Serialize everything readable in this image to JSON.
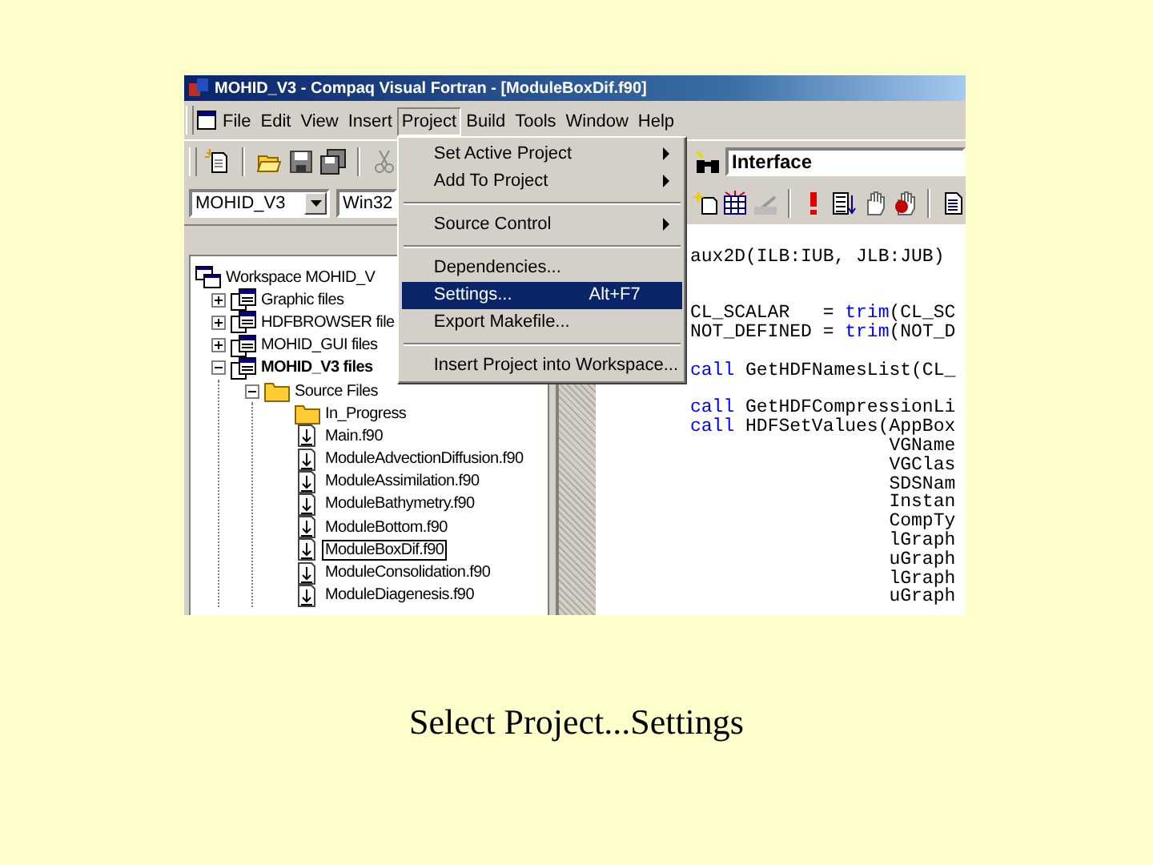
{
  "window": {
    "title": "MOHID_V3 - Compaq Visual Fortran - [ModuleBoxDif.f90]"
  },
  "menu_bar": [
    {
      "label": "File",
      "selected": false
    },
    {
      "label": "Edit",
      "selected": false
    },
    {
      "label": "View",
      "selected": false
    },
    {
      "label": "Insert",
      "selected": false
    },
    {
      "label": "Project",
      "selected": true
    },
    {
      "label": "Build",
      "selected": false
    },
    {
      "label": "Tools",
      "selected": false
    },
    {
      "label": "Window",
      "selected": false
    },
    {
      "label": "Help",
      "selected": false
    }
  ],
  "project_menu": {
    "items": [
      {
        "kind": "item",
        "label": "Set Active Project",
        "submenu": true,
        "selected": false
      },
      {
        "kind": "item",
        "label": "Add To Project",
        "submenu": true,
        "selected": false
      },
      {
        "kind": "separator"
      },
      {
        "kind": "item",
        "label": "Source Control",
        "submenu": true,
        "selected": false
      },
      {
        "kind": "separator"
      },
      {
        "kind": "item",
        "label": "Dependencies...",
        "submenu": false,
        "selected": false
      },
      {
        "kind": "item",
        "label": "Settings...",
        "shortcut": "Alt+F7",
        "submenu": false,
        "selected": true
      },
      {
        "kind": "item",
        "label": "Export Makefile...",
        "submenu": false,
        "selected": false
      },
      {
        "kind": "separator"
      },
      {
        "kind": "item",
        "label": "Insert Project into Workspace...",
        "submenu": false,
        "selected": false
      }
    ]
  },
  "toolbar": {
    "find_combo": "Interface",
    "project_combo": "MOHID_V3",
    "config_combo": "Win32"
  },
  "workspace": {
    "tree": [
      {
        "label": "Workspace MOHID_V",
        "kind": "workspace",
        "bold": false,
        "selected": false,
        "children": [
          {
            "label": "Graphic files",
            "kind": "project",
            "expanded": false,
            "bold": false,
            "selected": false
          },
          {
            "label": "HDFBROWSER file",
            "kind": "project",
            "expanded": false,
            "bold": false,
            "selected": false
          },
          {
            "label": "MOHID_GUI files",
            "kind": "project",
            "expanded": false,
            "bold": false,
            "selected": false
          },
          {
            "label": "MOHID_V3 files",
            "kind": "project",
            "expanded": true,
            "bold": true,
            "selected": false,
            "children": [
              {
                "label": "Source Files",
                "kind": "folder",
                "expanded": true,
                "bold": false,
                "selected": false,
                "children": [
                  {
                    "label": "In_Progress",
                    "kind": "folder",
                    "bold": false,
                    "selected": false
                  },
                  {
                    "label": "Main.f90",
                    "kind": "file",
                    "bold": false,
                    "selected": false
                  },
                  {
                    "label": "ModuleAdvectionDiffusion.f90",
                    "kind": "file",
                    "bold": false,
                    "selected": false
                  },
                  {
                    "label": "ModuleAssimilation.f90",
                    "kind": "file",
                    "bold": false,
                    "selected": false
                  },
                  {
                    "label": "ModuleBathymetry.f90",
                    "kind": "file",
                    "bold": false,
                    "selected": false
                  },
                  {
                    "label": "ModuleBottom.f90",
                    "kind": "file",
                    "bold": false,
                    "selected": false
                  },
                  {
                    "label": "ModuleBoxDif.f90",
                    "kind": "file",
                    "bold": false,
                    "selected": true
                  },
                  {
                    "label": "ModuleConsolidation.f90",
                    "kind": "file",
                    "bold": false,
                    "selected": false
                  },
                  {
                    "label": "ModuleDiagenesis.f90",
                    "kind": "file",
                    "bold": false,
                    "selected": false
                  }
                ]
              }
            ]
          }
        ]
      }
    ]
  },
  "editor": {
    "lines": [
      {
        "kind": "code",
        "segments": [
          {
            "kind": "plain",
            "text": "aux2D(ILB:IUB, JLB:JUB)"
          }
        ]
      },
      {
        "kind": "blank"
      },
      {
        "kind": "blank"
      },
      {
        "kind": "code",
        "segments": [
          {
            "kind": "plain",
            "text": "CL_SCALAR   = "
          },
          {
            "kind": "keyword",
            "text": "trim"
          },
          {
            "kind": "plain",
            "text": "(CL_SC"
          }
        ]
      },
      {
        "kind": "code",
        "segments": [
          {
            "kind": "plain",
            "text": "NOT_DEFINED = "
          },
          {
            "kind": "keyword",
            "text": "trim"
          },
          {
            "kind": "plain",
            "text": "(NOT_D"
          }
        ]
      },
      {
        "kind": "blank"
      },
      {
        "kind": "code",
        "segments": [
          {
            "kind": "keyword",
            "text": "call"
          },
          {
            "kind": "plain",
            "text": " GetHDFNamesList(CL_"
          }
        ]
      },
      {
        "kind": "blank"
      },
      {
        "kind": "code",
        "segments": [
          {
            "kind": "keyword",
            "text": "call"
          },
          {
            "kind": "plain",
            "text": " GetHDFCompressionLi"
          }
        ]
      },
      {
        "kind": "code",
        "segments": [
          {
            "kind": "keyword",
            "text": "call"
          },
          {
            "kind": "plain",
            "text": " HDFSetValues(AppBox"
          }
        ]
      },
      {
        "kind": "continued",
        "segments": [
          {
            "kind": "plain",
            "text": "VGName"
          }
        ]
      },
      {
        "kind": "continued",
        "segments": [
          {
            "kind": "plain",
            "text": "VGClas"
          }
        ]
      },
      {
        "kind": "continued",
        "segments": [
          {
            "kind": "plain",
            "text": "SDSNam"
          }
        ]
      },
      {
        "kind": "continued",
        "segments": [
          {
            "kind": "plain",
            "text": "Instan"
          }
        ]
      },
      {
        "kind": "continued",
        "segments": [
          {
            "kind": "plain",
            "text": "CompTy"
          }
        ]
      },
      {
        "kind": "continued",
        "segments": [
          {
            "kind": "plain",
            "text": "lGraph"
          }
        ]
      },
      {
        "kind": "continued",
        "segments": [
          {
            "kind": "plain",
            "text": "uGraph"
          }
        ]
      },
      {
        "kind": "continued",
        "segments": [
          {
            "kind": "plain",
            "text": "lGraph"
          }
        ]
      },
      {
        "kind": "continued",
        "segments": [
          {
            "kind": "plain",
            "text": "uGraph"
          }
        ]
      }
    ]
  },
  "slide": {
    "caption": "Select Project...Settings"
  }
}
